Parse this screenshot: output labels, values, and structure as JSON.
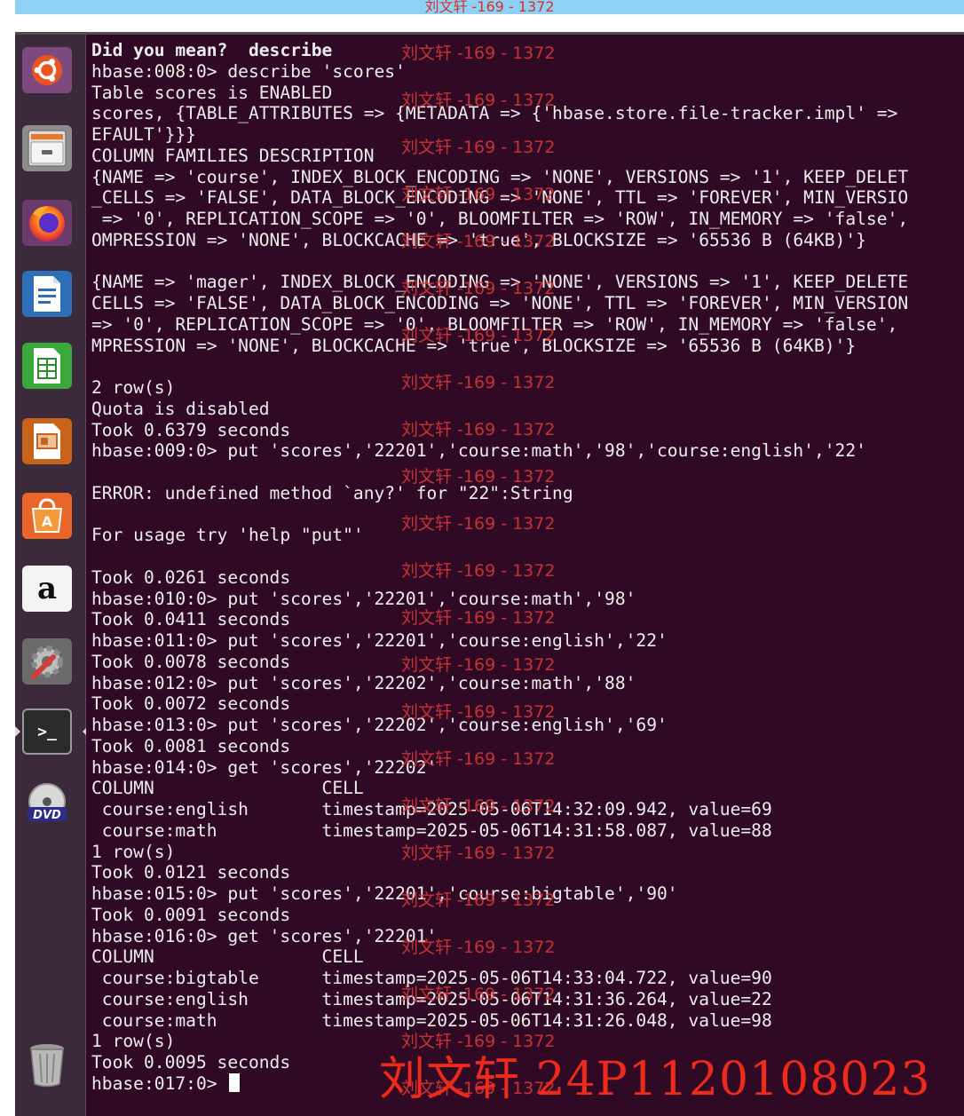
{
  "watermark_text": "刘文轩 -169 - 1372",
  "signature_text": "刘文轩  24P1120108023",
  "launcher": {
    "items": [
      {
        "name": "dash-icon"
      },
      {
        "name": "files-icon"
      },
      {
        "name": "firefox-icon"
      },
      {
        "name": "libreoffice-writer-icon"
      },
      {
        "name": "libreoffice-calc-icon"
      },
      {
        "name": "libreoffice-impress-icon"
      },
      {
        "name": "software-center-icon"
      },
      {
        "name": "amazon-icon",
        "glyph": "a"
      },
      {
        "name": "system-settings-icon"
      },
      {
        "name": "terminal-icon",
        "glyph": ">_"
      },
      {
        "name": "dvd-icon",
        "glyph": "DVD"
      },
      {
        "name": "trash-icon"
      }
    ]
  },
  "terminal": {
    "lines": [
      "Did you mean?  describe",
      "hbase:008:0> describe 'scores'",
      "Table scores is ENABLED",
      "scores, {TABLE_ATTRIBUTES => {METADATA => {'hbase.store.file-tracker.impl' =>",
      "EFAULT'}}}",
      "COLUMN FAMILIES DESCRIPTION",
      "{NAME => 'course', INDEX_BLOCK_ENCODING => 'NONE', VERSIONS => '1', KEEP_DELET",
      "_CELLS => 'FALSE', DATA_BLOCK_ENCODING => 'NONE', TTL => 'FOREVER', MIN_VERSIO",
      " => '0', REPLICATION_SCOPE => '0', BLOOMFILTER => 'ROW', IN_MEMORY => 'false',",
      "OMPRESSION => 'NONE', BLOCKCACHE => 'true', BLOCKSIZE => '65536 B (64KB)'}",
      "",
      "{NAME => 'mager', INDEX_BLOCK_ENCODING => 'NONE', VERSIONS => '1', KEEP_DELETE",
      "CELLS => 'FALSE', DATA_BLOCK_ENCODING => 'NONE', TTL => 'FOREVER', MIN_VERSION",
      "=> '0', REPLICATION_SCOPE => '0', BLOOMFILTER => 'ROW', IN_MEMORY => 'false',",
      "MPRESSION => 'NONE', BLOCKCACHE => 'true', BLOCKSIZE => '65536 B (64KB)'}",
      "",
      "2 row(s)",
      "Quota is disabled",
      "Took 0.6379 seconds",
      "hbase:009:0> put 'scores','22201','course:math','98','course:english','22'",
      "",
      "ERROR: undefined method `any?' for \"22\":String",
      "",
      "For usage try 'help \"put\"'",
      "",
      "Took 0.0261 seconds",
      "hbase:010:0> put 'scores','22201','course:math','98'",
      "Took 0.0411 seconds",
      "hbase:011:0> put 'scores','22201','course:english','22'",
      "Took 0.0078 seconds",
      "hbase:012:0> put 'scores','22202','course:math','88'",
      "Took 0.0072 seconds",
      "hbase:013:0> put 'scores','22202','course:english','69'",
      "Took 0.0081 seconds",
      "hbase:014:0> get 'scores','22202'",
      "COLUMN                CELL",
      " course:english       timestamp=2025-05-06T14:32:09.942, value=69",
      " course:math          timestamp=2025-05-06T14:31:58.087, value=88",
      "1 row(s)",
      "Took 0.0121 seconds",
      "hbase:015:0> put 'scores','22201','course:bigtable','90'",
      "Took 0.0091 seconds",
      "hbase:016:0> get 'scores','22201'",
      "COLUMN                CELL",
      " course:bigtable      timestamp=2025-05-06T14:33:04.722, value=90",
      " course:english       timestamp=2025-05-06T14:31:36.264, value=22",
      " course:math          timestamp=2025-05-06T14:31:26.048, value=98",
      "1 row(s)",
      "Took 0.0095 seconds"
    ],
    "prompt": "hbase:017:0> "
  },
  "colors": {
    "terminal_bg": "#300a24",
    "terminal_fg": "#ececec",
    "launcher_bg": "#3a2a3a",
    "watermark": "#e03a3a"
  }
}
